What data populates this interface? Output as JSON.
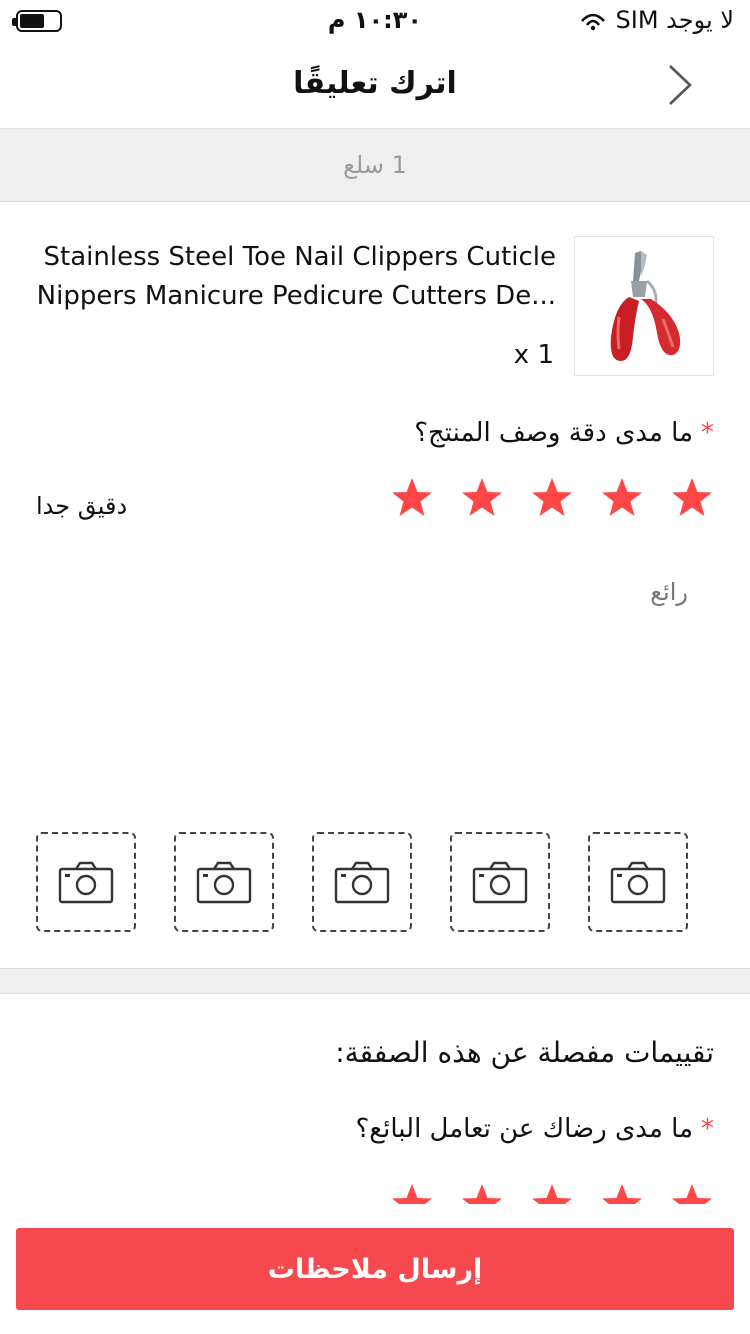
{
  "status_bar": {
    "carrier": "لا يوجد SIM",
    "time": "١٠:٣٠ م"
  },
  "nav": {
    "title": "اترك تعليقًا",
    "back_icon": "chevron-right-icon"
  },
  "item_count": "1 سلع",
  "product": {
    "title": "Stainless Steel Toe Nail Clippers Cuticle Nippers Manicure Pedicure Cutters De...",
    "quantity": "x 1",
    "thumbnail_icon": "nail-clipper-image"
  },
  "accuracy": {
    "question": "ما مدى دقة وصف المنتج؟",
    "required_mark": "*",
    "stars_filled": 5,
    "stars_total": 5,
    "rating_label": "دقيق جدا",
    "comment": "رائع"
  },
  "photos": {
    "slot_count": 5,
    "icon": "camera-icon"
  },
  "detailed_ratings": {
    "title": "تقييمات مفصلة عن هذه الصفقة:",
    "seller_question": "ما مدى رضاك عن تعامل البائع؟",
    "required_mark": "*",
    "stars_filled": 5,
    "stars_total": 5
  },
  "submit_label": "إرسال ملاحظات",
  "colors": {
    "accent": "#ff4747",
    "button": "#f5484f",
    "band": "#efefef"
  }
}
